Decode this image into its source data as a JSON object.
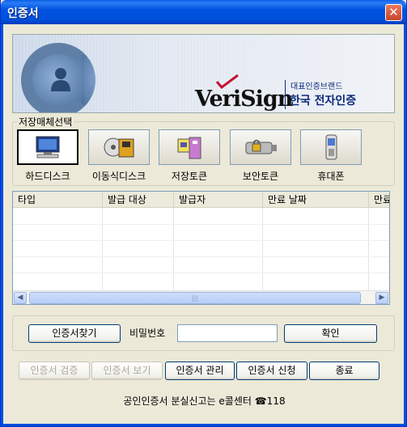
{
  "window": {
    "title": "인증서"
  },
  "banner": {
    "brand": "VeriSign",
    "tagline": "대표인증브랜드",
    "partner": "한국 전자인증"
  },
  "media": {
    "group_label": "저장매체선택",
    "items": [
      {
        "label": "하드디스크",
        "icon": "computer-icon",
        "selected": true
      },
      {
        "label": "이동식디스크",
        "icon": "removable-disk-icon",
        "selected": false
      },
      {
        "label": "저장토큰",
        "icon": "usb-token-icon",
        "selected": false
      },
      {
        "label": "보안토큰",
        "icon": "security-token-icon",
        "selected": false
      },
      {
        "label": "휴대폰",
        "icon": "phone-icon",
        "selected": false
      }
    ]
  },
  "table": {
    "columns": [
      "타입",
      "발급 대상",
      "발급자",
      "만료 날짜",
      "만료"
    ],
    "rows": []
  },
  "actions": {
    "find_cert": "인증서찾기",
    "password_label": "비밀번호",
    "password_value": "",
    "confirm": "확인"
  },
  "bottom_buttons": {
    "verify": "인증서 검증",
    "view": "인증서 보기",
    "manage": "인증서 관리",
    "apply": "인증서 신청",
    "exit": "종료"
  },
  "footer": {
    "text": "공인인증서 분실신고는  e콜센터 ☎118"
  }
}
